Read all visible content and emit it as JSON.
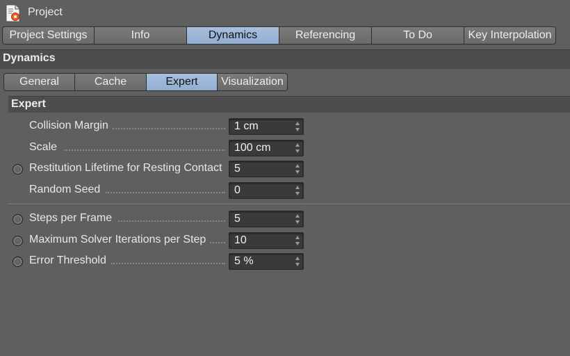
{
  "window": {
    "title": "Project",
    "icon": "project-settings-icon"
  },
  "main_tabs": [
    {
      "label": "Project Settings",
      "active": false
    },
    {
      "label": "Info",
      "active": false
    },
    {
      "label": "Dynamics",
      "active": true
    },
    {
      "label": "Referencing",
      "active": false
    },
    {
      "label": "To Do",
      "active": false
    },
    {
      "label": "Key Interpolation",
      "active": false
    }
  ],
  "section": {
    "title": "Dynamics"
  },
  "sub_tabs": [
    {
      "label": "General",
      "active": false
    },
    {
      "label": "Cache",
      "active": false
    },
    {
      "label": "Expert",
      "active": true
    },
    {
      "label": "Visualization",
      "active": false
    }
  ],
  "group": {
    "title": "Expert"
  },
  "rows": [
    {
      "label": "Collision Margin",
      "value": "1 cm",
      "has_radio": false
    },
    {
      "label": "Scale",
      "value": "100 cm",
      "has_radio": false
    },
    {
      "label": "Restitution Lifetime for Resting Contact",
      "value": "5",
      "has_radio": true
    },
    {
      "label": "Random Seed",
      "value": "0",
      "has_radio": false
    },
    {
      "label": "Steps per Frame",
      "value": "5",
      "has_radio": true
    },
    {
      "label": "Maximum Solver Iterations per Step",
      "value": "10",
      "has_radio": true
    },
    {
      "label": "Error Threshold",
      "value": "5 %",
      "has_radio": true
    }
  ],
  "colors": {
    "panel_bg": "#5f5f5f",
    "active_tab": "#9bb4d8",
    "header_bg": "#4d4d4d",
    "field_bg": "#3a3a3a"
  }
}
